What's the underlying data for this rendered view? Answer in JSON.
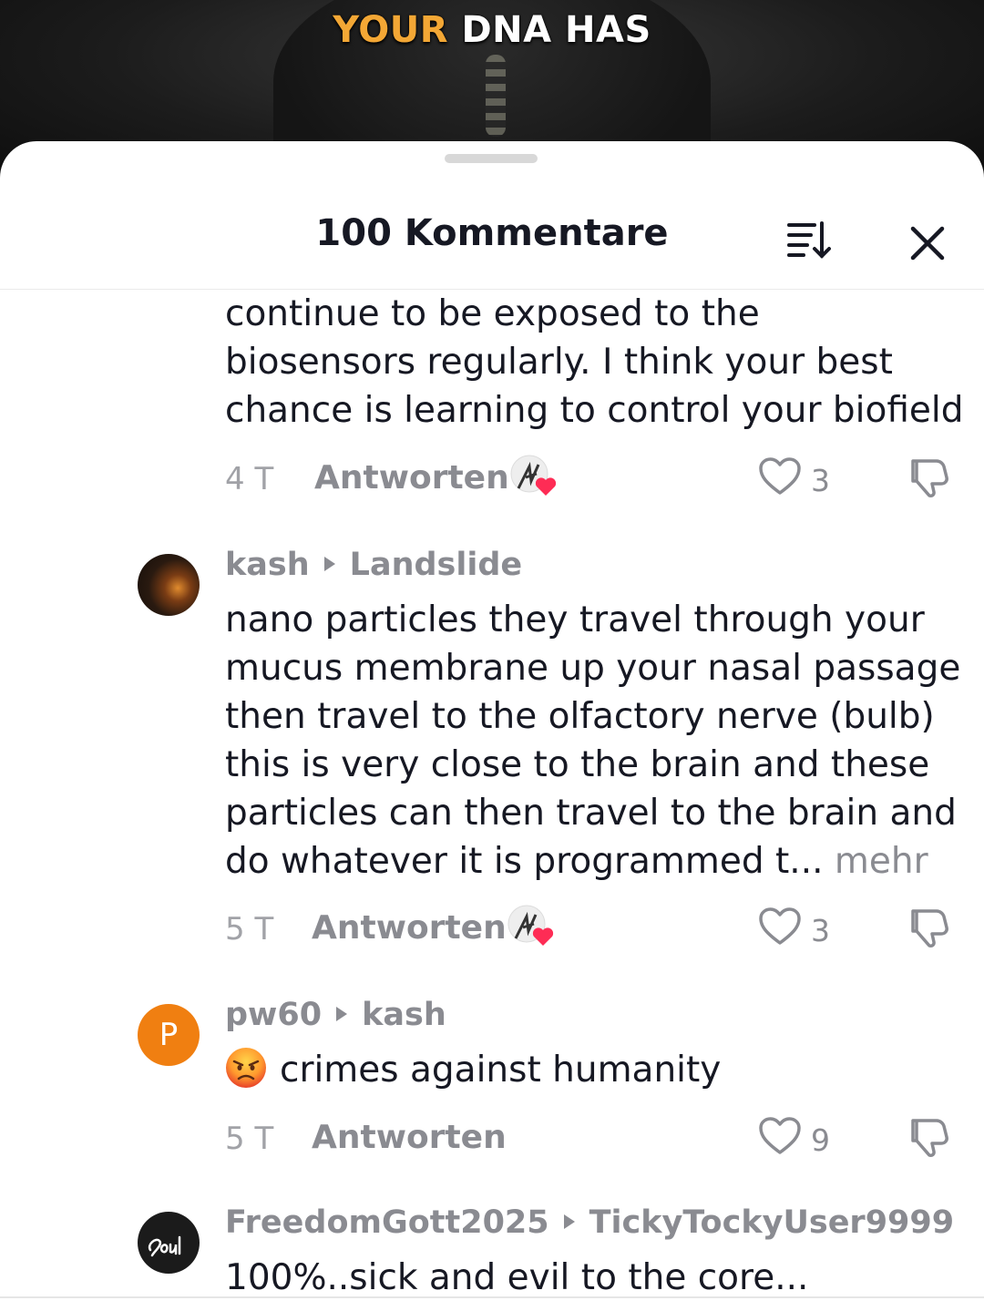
{
  "video": {
    "caption_highlight": "YOUR",
    "caption_rest": "DNA HAS"
  },
  "sheet": {
    "title": "100 Kommentare",
    "sort_icon": "sort-icon",
    "close_icon": "close-icon"
  },
  "comments": [
    {
      "text": "continue to be exposed to the\nbiosensors regularly. I think your best\nchance is learning to control your biofield",
      "time": "4 T",
      "reply_label": "Antworten",
      "creator_liked": true,
      "likes": "3"
    },
    {
      "username": "kash",
      "reply_to": "Landslide",
      "text": "nano particles they travel through your\nmucus membrane up your nasal passage\nthen travel to the olfactory nerve (bulb)\nthis is very close to the brain and these\nparticles can then travel to the brain and\ndo whatever it is programmed t...",
      "more_label": "mehr",
      "time": "5 T",
      "reply_label": "Antworten",
      "creator_liked": true,
      "likes": "3"
    },
    {
      "username": "pw60",
      "avatar_letter": "P",
      "reply_to": "kash",
      "emoji": "angry-face-emoji",
      "text": "crimes against humanity",
      "time": "5 T",
      "reply_label": "Antworten",
      "creator_liked": false,
      "likes": "9"
    },
    {
      "username": "FreedomGott2025",
      "reply_to": "TickyTockyUser9999",
      "text": "100%..sick and evil to the core..."
    }
  ],
  "colors": {
    "accent_caption": "#f3a735",
    "heart_red": "#fe2c55",
    "secondary_text": "#8a8b91",
    "avatar_orange": "#f07f11"
  }
}
